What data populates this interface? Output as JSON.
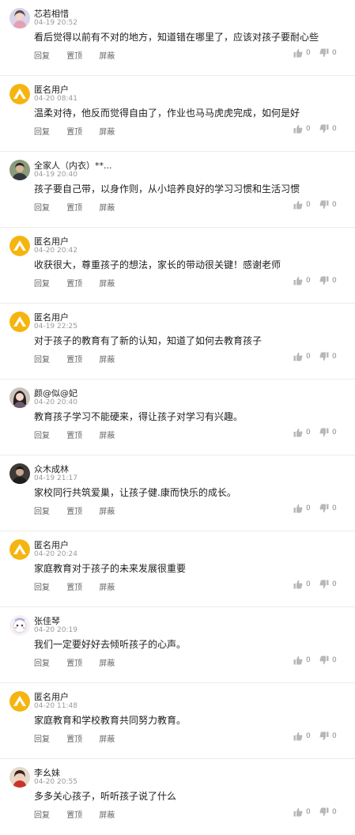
{
  "actions": {
    "reply": "回复",
    "pin": "置顶",
    "block": "屏蔽"
  },
  "comments": [
    {
      "name": "芯若相惜",
      "time": "04-19 20:52",
      "text": "看后觉得以前有不对的地方，知道错在哪里了，应该对孩子要耐心些",
      "likes": "0",
      "dislikes": "0",
      "avatar": "photo-girl"
    },
    {
      "name": "匿名用户",
      "time": "04-20 08:41",
      "text": "温柔对待，他反而觉得自由了，作业也马马虎虎完成，如何是好",
      "likes": "0",
      "dislikes": "0",
      "avatar": "anonymous-logo"
    },
    {
      "name": "全家人（内衣）**...",
      "time": "04-19 20:40",
      "text": "孩子要自己带，以身作则，从小培养良好的学习习惯和生活习惯",
      "likes": "0",
      "dislikes": "0",
      "avatar": "photo-man"
    },
    {
      "name": "匿名用户",
      "time": "04-20 20:42",
      "text": "收获很大，尊重孩子的想法，家长的带动很关键！感谢老师",
      "likes": "0",
      "dislikes": "0",
      "avatar": "anonymous-logo"
    },
    {
      "name": "匿名用户",
      "time": "04-19 22:25",
      "text": "对于孩子的教育有了新的认知，知道了如何去教育孩子",
      "likes": "0",
      "dislikes": "0",
      "avatar": "anonymous-logo"
    },
    {
      "name": "颜@似@妃",
      "time": "04-20 20:40",
      "text": "教育孩子学习不能硬来，得让孩子对学习有兴趣。",
      "likes": "0",
      "dislikes": "0",
      "avatar": "photo-woman"
    },
    {
      "name": "众木成林",
      "time": "04-19 21:17",
      "text": "家校同行共筑爱巢，让孩子健.康而快乐的成长。",
      "likes": "0",
      "dislikes": "0",
      "avatar": "photo-dark"
    },
    {
      "name": "匿名用户",
      "time": "04-20 20:24",
      "text": "家庭教育对于孩子的未来发展很重要",
      "likes": "0",
      "dislikes": "0",
      "avatar": "anonymous-logo"
    },
    {
      "name": "张佳琴",
      "time": "04-20 20:19",
      "text": "我们一定要好好去倾听孩子的心声。",
      "likes": "0",
      "dislikes": "0",
      "avatar": "photo-cartoon"
    },
    {
      "name": "匿名用户",
      "time": "04-20 11:48",
      "text": "家庭教育和学校教育共同努力教育。",
      "likes": "0",
      "dislikes": "0",
      "avatar": "anonymous-logo"
    },
    {
      "name": "李幺妹",
      "time": "04-20 20:55",
      "text": "多多关心孩子，听听孩子说了什么",
      "likes": "0",
      "dislikes": "0",
      "avatar": "photo-red"
    }
  ],
  "colors": {
    "anonymous": "#f5b40f",
    "divider": "#ececec",
    "meta": "#9a9a9a"
  }
}
